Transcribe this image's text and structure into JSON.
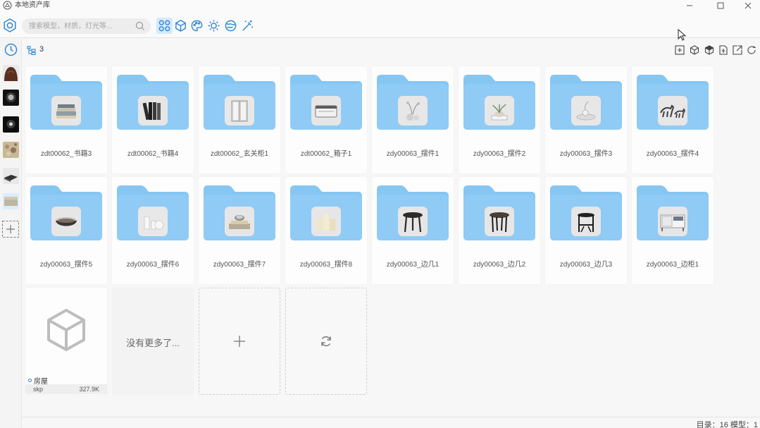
{
  "window": {
    "title": "本地资产库"
  },
  "search": {
    "placeholder": "搜索模型，材质，灯光等..."
  },
  "toolbar": {
    "filters": [
      {
        "icon": "grid-four-icon",
        "active": true
      },
      {
        "icon": "cube-icon",
        "active": false
      },
      {
        "icon": "palette-icon",
        "active": false
      },
      {
        "icon": "sun-light-icon",
        "active": false
      },
      {
        "icon": "globe-texture-icon",
        "active": false
      },
      {
        "icon": "magic-wand-icon",
        "active": false
      }
    ]
  },
  "rail": {
    "items": [
      {
        "icon": "history-clock-icon"
      },
      {
        "icon": "material-brown-thumb-icon"
      },
      {
        "icon": "light-spot-thumb-icon"
      },
      {
        "icon": "light-glow-thumb-icon"
      },
      {
        "icon": "stone-texture-thumb-icon"
      },
      {
        "icon": "device-thumb-icon"
      },
      {
        "icon": "fabric-thumb-icon",
        "selected": true
      },
      {
        "icon": "add-library-icon"
      }
    ]
  },
  "subbar": {
    "count": "3",
    "actions": [
      "add-folder-icon",
      "cube-outline-icon",
      "cube-solid-icon",
      "import-icon",
      "export-icon",
      "refresh-icon"
    ]
  },
  "folders": [
    {
      "label": "zdt00062_书籍3",
      "thumb": "books-flat"
    },
    {
      "label": "zdt00062_书籍4",
      "thumb": "books-standing"
    },
    {
      "label": "zdt00062_玄关柜1",
      "thumb": "cabinet"
    },
    {
      "label": "zdt00062_箱子1",
      "thumb": "box"
    },
    {
      "label": "zdy00063_摆件1",
      "thumb": "vase-plant"
    },
    {
      "label": "zdy00063_摆件2",
      "thumb": "plant-bowl"
    },
    {
      "label": "zdy00063_摆件3",
      "thumb": "tray-deco"
    },
    {
      "label": "zdy00063_摆件4",
      "thumb": "horses"
    },
    {
      "label": "zdy00063_摆件5",
      "thumb": "bowl"
    },
    {
      "label": "zdy00063_摆件6",
      "thumb": "candles-white"
    },
    {
      "label": "zdy00063_摆件7",
      "thumb": "tray-books"
    },
    {
      "label": "zdy00063_摆件8",
      "thumb": "candles-cream"
    },
    {
      "label": "zdy00063_边几1",
      "thumb": "side-table-round"
    },
    {
      "label": "zdy00063_边几2",
      "thumb": "side-table-dark"
    },
    {
      "label": "zdy00063_边几3",
      "thumb": "side-table-frame"
    },
    {
      "label": "zdy00063_边柜1",
      "thumb": "sideboard"
    }
  ],
  "house": {
    "name": "房屋",
    "format": "skp",
    "size": "327.9K"
  },
  "grid_tail": {
    "no_more": "没有更多了..."
  },
  "status": {
    "text": "目录：16 模型：1"
  }
}
